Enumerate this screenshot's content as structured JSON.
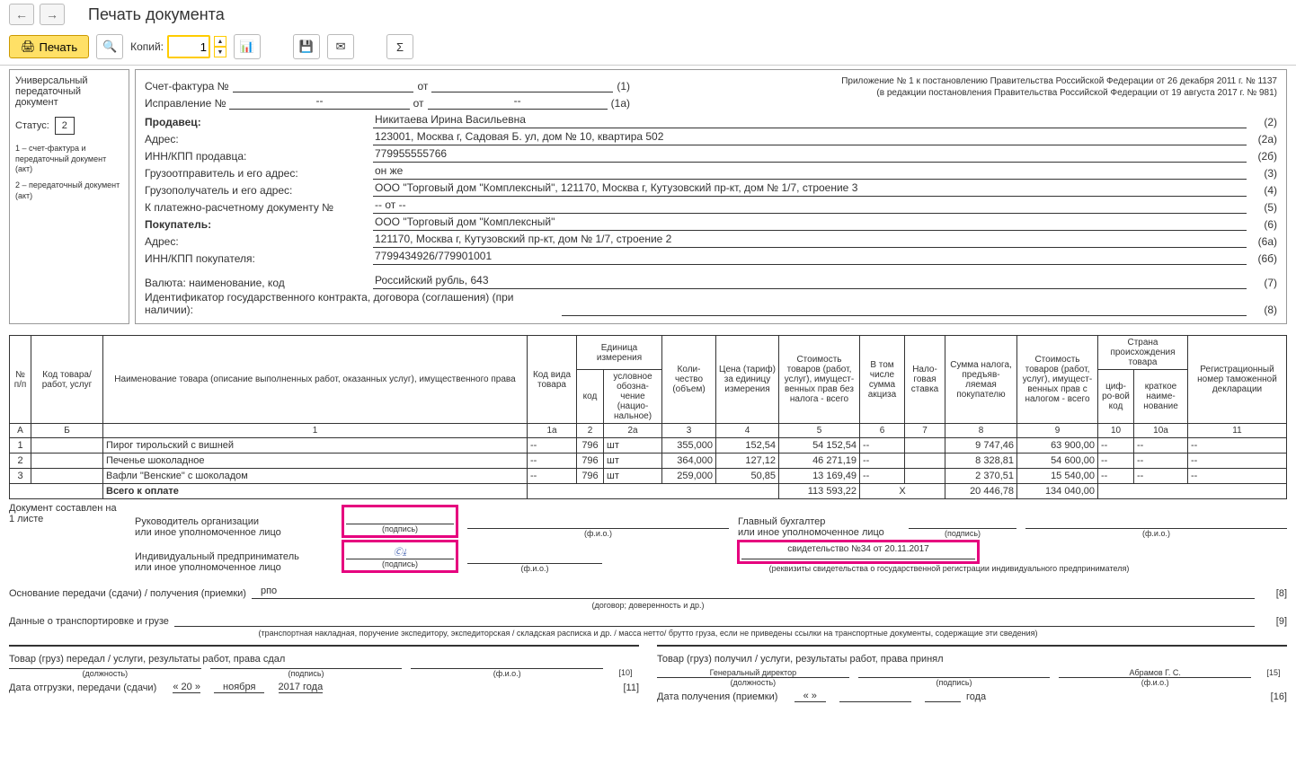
{
  "title": "Печать документа",
  "toolbar": {
    "print": "Печать",
    "copies_label": "Копий:",
    "copies_value": "1"
  },
  "sidebar": {
    "line1": "Универсальный",
    "line2": "передаточный",
    "line3": "документ",
    "status_label": "Статус:",
    "status_value": "2",
    "legend1": "1 – счет-фактура и передаточный документ (акт)",
    "legend2": "2 – передаточный документ (акт)"
  },
  "headerRight": {
    "l1": "Приложение № 1 к постановлению Правительства Российской Федерации от 26 декабря 2011 г. № 1137",
    "l2": "(в редакции постановления Правительства Российской Федерации от 19 августа 2017 г. № 981)"
  },
  "topFields": {
    "sfLabel": "Счет-фактура №",
    "sfFrom": "от",
    "sfNum": "(1)",
    "corrLabel": "Исправление №",
    "corrVal": "--",
    "corrFrom": "от",
    "corrFromVal": "--",
    "corrNum": "(1а)"
  },
  "fields": [
    {
      "label": "Продавец:",
      "bold": true,
      "value": "Никитаева Ирина Васильевна",
      "num": "(2)"
    },
    {
      "label": "Адрес:",
      "value": "123001, Москва г, Садовая Б. ул, дом № 10, квартира 502",
      "num": "(2а)"
    },
    {
      "label": "ИНН/КПП продавца:",
      "value": "779955555766",
      "num": "(2б)"
    },
    {
      "label": "Грузоотправитель и его адрес:",
      "value": "он же",
      "num": "(3)"
    },
    {
      "label": "Грузополучатель и его адрес:",
      "value": "ООО \"Торговый дом \"Комплексный\", 121170, Москва г, Кутузовский пр-кт, дом № 1/7, строение 3",
      "num": "(4)"
    },
    {
      "label": "К платежно-расчетному документу №",
      "value": "-- от --",
      "num": "(5)"
    },
    {
      "label": "Покупатель:",
      "bold": true,
      "value": "ООО \"Торговый дом \"Комплексный\"",
      "num": "(6)"
    },
    {
      "label": "Адрес:",
      "value": "121170, Москва г, Кутузовский пр-кт, дом № 1/7, строение 2",
      "num": "(6а)"
    },
    {
      "label": "ИНН/КПП покупателя:",
      "value": "7799434926/779901001",
      "num": "(6б)"
    },
    {
      "label": "Валюта: наименование, код",
      "value": "Российский рубль, 643",
      "num": "(7)",
      "spacer": true
    },
    {
      "label": "Идентификатор государственного контракта, договора (соглашения) (при наличии):",
      "wide": true,
      "value": "",
      "num": "(8)"
    }
  ],
  "tableHeaders": {
    "np": "№\nп/п",
    "code": "Код товара/\nработ, услуг",
    "name": "Наименование товара (описание выполненных работ, оказанных услуг), имущественного права",
    "kind": "Код вида товара",
    "unit": "Единица измерения",
    "unitCode": "код",
    "unitName": "условное обозна-чение (нацио-нальное)",
    "qty": "Коли-чество (объем)",
    "price": "Цена (тариф) за единицу измерения",
    "cost": "Стоимость товаров (работ, услуг), имущест-венных прав без налога - всего",
    "excise": "В том числе сумма акциза",
    "rate": "Нало-говая ставка",
    "tax": "Сумма налога, предъяв-ляемая покупателю",
    "costTax": "Стоимость товаров (работ, услуг), имущест-венных прав с налогом - всего",
    "country": "Страна происхождения товара",
    "countryCode": "циф-ро-вой код",
    "countryName": "краткое наиме-нование",
    "reg": "Регистрационный номер таможенной декларации",
    "row2": {
      "a": "А",
      "b": "Б",
      "c1": "1",
      "c1a": "1а",
      "c2": "2",
      "c2a": "2а",
      "c3": "3",
      "c4": "4",
      "c5": "5",
      "c6": "6",
      "c7": "7",
      "c8": "8",
      "c9": "9",
      "c10": "10",
      "c10a": "10а",
      "c11": "11"
    }
  },
  "rows": [
    {
      "n": "1",
      "name": "Пирог тирольский с вишней",
      "kind": "--",
      "ucode": "796",
      "uname": "шт",
      "qty": "355,000",
      "price": "152,54",
      "cost": "54 152,54",
      "exc": "--",
      "rate": "",
      "tax": "9 747,46",
      "total": "63 900,00",
      "cc": "--",
      "cn": "--",
      "reg": "--"
    },
    {
      "n": "2",
      "name": "Печенье шоколадное",
      "kind": "--",
      "ucode": "796",
      "uname": "шт",
      "qty": "364,000",
      "price": "127,12",
      "cost": "46 271,19",
      "exc": "--",
      "rate": "",
      "tax": "8 328,81",
      "total": "54 600,00",
      "cc": "--",
      "cn": "--",
      "reg": "--"
    },
    {
      "n": "3",
      "name": "Вафли \"Венские\" с шоколадом",
      "kind": "--",
      "ucode": "796",
      "uname": "шт",
      "qty": "259,000",
      "price": "50,85",
      "cost": "13 169,49",
      "exc": "--",
      "rate": "",
      "tax": "2 370,51",
      "total": "15 540,00",
      "cc": "--",
      "cn": "--",
      "reg": "--"
    }
  ],
  "total": {
    "label": "Всего к оплате",
    "cost": "113 593,22",
    "x": "Х",
    "tax": "20 446,78",
    "total": "134 040,00"
  },
  "signatures": {
    "docOn": "Документ составлен на",
    "sheets": "1 листе",
    "leader": "Руководитель организации",
    "orOther": "или иное уполномоченное лицо",
    "chiefAcc": "Главный бухгалтер",
    "orOther2": "или иное уполномоченное лицо",
    "ip": "Индивидуальный предприниматель",
    "orOther3": "или иное уполномоченное лицо",
    "sign": "(подпись)",
    "fio": "(ф.и.о.)",
    "cert": "свидетельство №34 от 20.11.2017",
    "certHint": "(реквизиты свидетельства о государственной регистрации индивидуального предпринимателя)"
  },
  "bottom": {
    "basis": "Основание передачи (сдачи) / получения (приемки)",
    "basisVal": "рпо",
    "basisNum": "[8]",
    "basisHint": "(договор; доверенность и др.)",
    "transport": "Данные о транспортировке и грузе",
    "transportNum": "[9]",
    "transportHint": "(транспортная накладная, поручение экспедитору, экспедиторская / складская расписка и др. / масса нетто/ брутто груза, если не приведены ссылки на транспортные документы, содержащие эти сведения)",
    "left": {
      "title": "Товар (груз) передал / услуги, результаты работ, права сдал",
      "num": "[10]",
      "pos": "(должность)",
      "sign": "(подпись)",
      "fio": "(ф.и.о.)",
      "dateLabel": "Дата отгрузки, передачи (сдачи)",
      "d": "« 20 »",
      "m": "ноября",
      "y": "2017  года",
      "dn": "[11]"
    },
    "right": {
      "title": "Товар (груз) получил / услуги, результаты работ, права принял",
      "num": "[15]",
      "director": "Генеральный директор",
      "name": "Абрамов Г. С.",
      "pos": "(должность)",
      "sign": "(подпись)",
      "fio": "(ф.и.о.)",
      "dateLabel": "Дата получения (приемки)",
      "d": "«      »",
      "y": "года",
      "dn": "[16]"
    }
  }
}
